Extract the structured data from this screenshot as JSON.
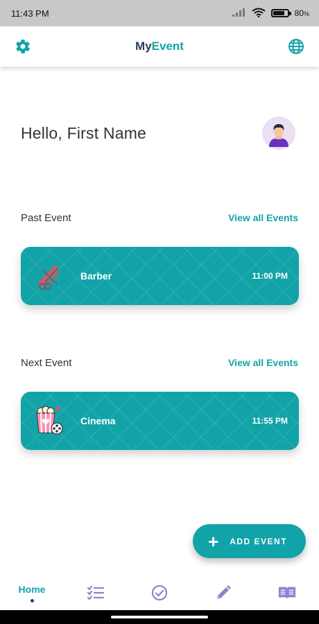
{
  "status_bar": {
    "time": "11:43 PM",
    "battery_percent": "80",
    "battery_suffix": "%"
  },
  "app_bar": {
    "title_part1": "My",
    "title_part2": "Event"
  },
  "greeting": "Hello, First Name",
  "past_section": {
    "title": "Past Event",
    "view_all": "View all Events",
    "event": {
      "name": "Barber",
      "time": "11:00 PM",
      "icon": "barber-icon"
    }
  },
  "next_section": {
    "title": "Next Event",
    "view_all": "View all Events",
    "event": {
      "name": "Cinema",
      "time": "11:55 PM",
      "icon": "cinema-icon"
    }
  },
  "fab": {
    "icon": "+",
    "label": "ADD EVENT"
  },
  "bottom_nav": {
    "home": "Home",
    "items": [
      "home",
      "checklist-icon",
      "check-circle-icon",
      "pencil-icon",
      "book-icon"
    ]
  },
  "colors": {
    "accent": "#12a3a8",
    "nav_icon": "#8a86c9",
    "dot": "#233b8c"
  }
}
